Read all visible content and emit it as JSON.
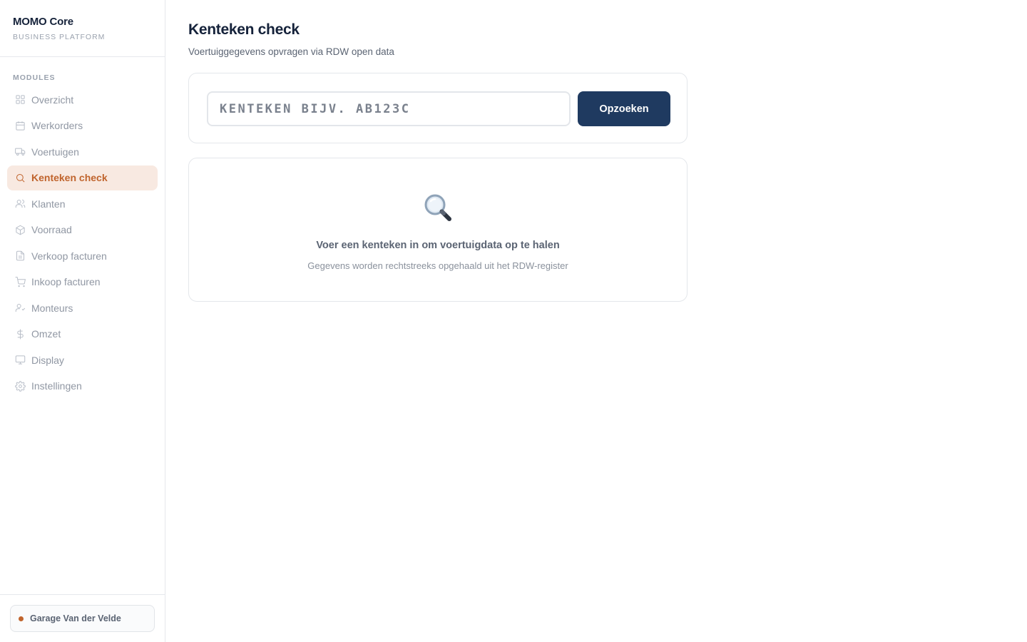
{
  "brand": {
    "title": "MOMO Core",
    "subtitle": "BUSINESS PLATFORM"
  },
  "sidebar": {
    "section_label": "MODULES",
    "items": [
      {
        "label": "Overzicht",
        "icon": "grid-icon",
        "active": false
      },
      {
        "label": "Werkorders",
        "icon": "calendar-icon",
        "active": false
      },
      {
        "label": "Voertuigen",
        "icon": "truck-icon",
        "active": false
      },
      {
        "label": "Kenteken check",
        "icon": "search-icon",
        "active": true
      },
      {
        "label": "Klanten",
        "icon": "users-icon",
        "active": false
      },
      {
        "label": "Voorraad",
        "icon": "package-icon",
        "active": false
      },
      {
        "label": "Verkoop facturen",
        "icon": "file-icon",
        "active": false
      },
      {
        "label": "Inkoop facturen",
        "icon": "cart-icon",
        "active": false
      },
      {
        "label": "Monteurs",
        "icon": "user-check-icon",
        "active": false
      },
      {
        "label": "Omzet",
        "icon": "dollar-icon",
        "active": false
      },
      {
        "label": "Display",
        "icon": "monitor-icon",
        "active": false
      },
      {
        "label": "Instellingen",
        "icon": "settings-icon",
        "active": false
      }
    ],
    "footer": {
      "garage_name": "Garage Van der Velde"
    }
  },
  "main": {
    "title": "Kenteken check",
    "subtitle": "Voertuiggegevens opvragen via RDW open data",
    "search": {
      "placeholder": "KENTEKEN BIJV. AB123C",
      "value": "",
      "button_label": "Opzoeken"
    },
    "empty_state": {
      "icon": "magnifier-icon",
      "title": "Voer een kenteken in om voertuigdata op te halen",
      "subtitle": "Gegevens worden rechtstreeks opgehaald uit het RDW-register"
    }
  },
  "colors": {
    "accent": "#c0642d",
    "accent_bg": "#f8e9e1",
    "primary_button": "#1f3a60",
    "text_dark": "#15223a"
  }
}
